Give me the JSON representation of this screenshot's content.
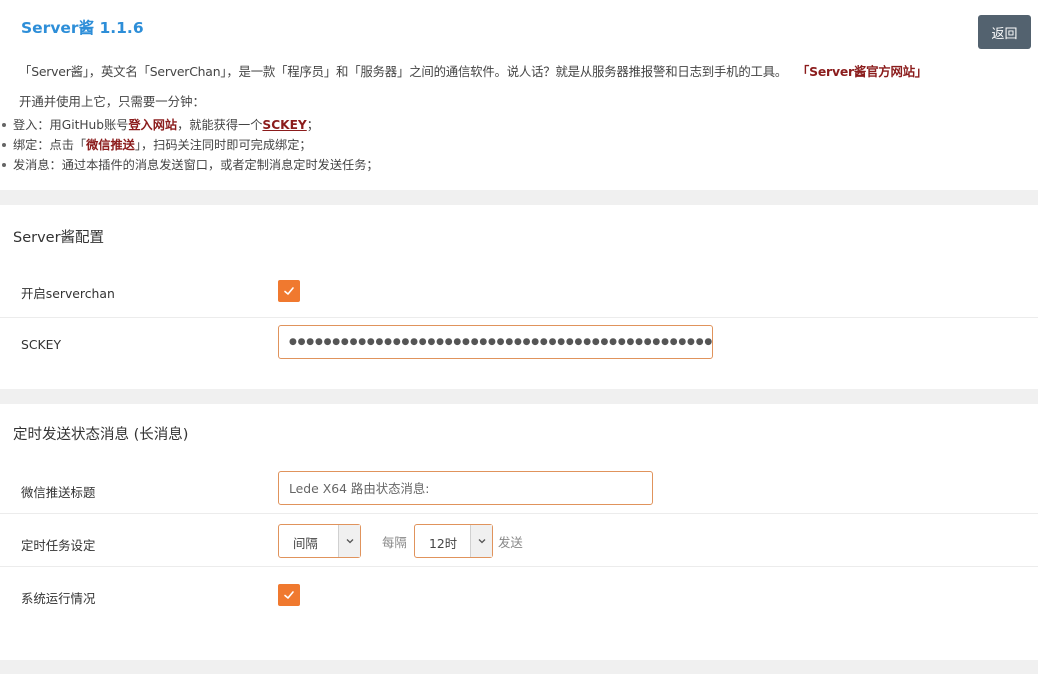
{
  "header": {
    "title": "Server酱 1.1.6",
    "back_label": "返回"
  },
  "intro": {
    "description": "「Server酱」，英文名「ServerChan」，是一款「程序员」和「服务器」之间的通信软件。说人话？就是从服务器推报警和日志到手机的工具。",
    "official_link": "「Server酱官方网站」",
    "setup_text": "开通并使用上它，只需要一分钟：",
    "steps": [
      {
        "pre": "登入：用GitHub账号",
        "link": "登入网站",
        "mid": "，就能获得一个",
        "link2": "SCKEY",
        "post": "；"
      },
      {
        "pre": "绑定：点击「",
        "link": "微信推送",
        "post": "」，扫码关注同时即可完成绑定；"
      },
      {
        "text": "发消息：通过本插件的消息发送窗口，或者定制消息定时发送任务；"
      }
    ]
  },
  "config": {
    "title": "Server酱配置",
    "enable_label": "开启serverchan",
    "enable_checked": true,
    "sckey_label": "SCKEY",
    "sckey_value": "●●●●●●●●●●●●●●●●●●●●●●●●●●●●●●●●●●●●●●●●●●●●●●●●●●●●●●●●"
  },
  "schedule": {
    "title": "定时发送状态消息 (长消息)",
    "push_title_label": "微信推送标题",
    "push_title_value": "Lede X64 路由状态消息:",
    "task_label": "定时任务设定",
    "interval_value": "间隔",
    "every_text": "每隔",
    "hours_value": "12时",
    "send_text": "发送",
    "system_label": "系统运行情况",
    "system_checked": true
  },
  "colors": {
    "accent": "#f0792f",
    "title_blue": "#2d8ed8",
    "link_red": "#8b1c1c",
    "button_dark": "#53626f"
  }
}
